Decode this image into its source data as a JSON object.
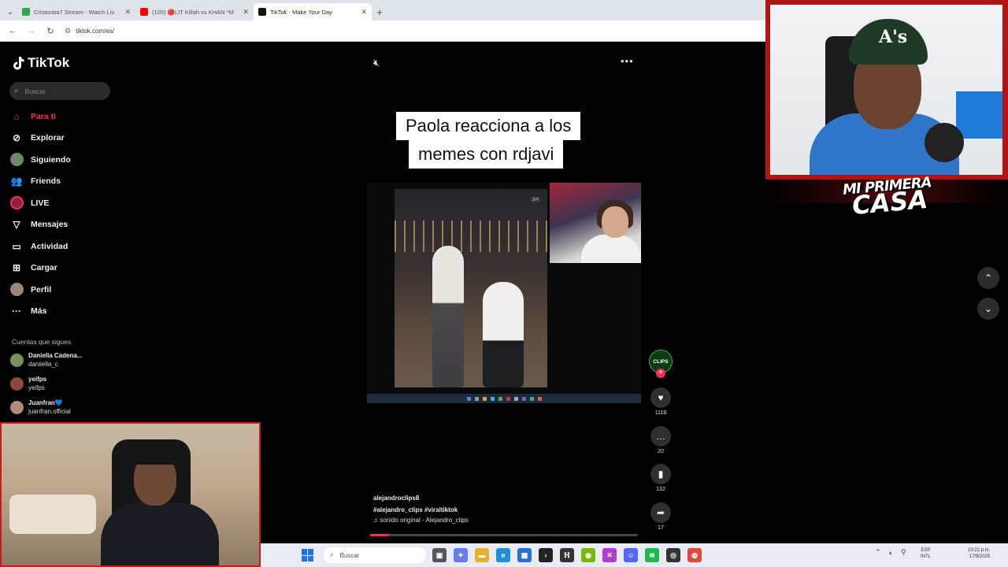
{
  "browser": {
    "tabs": [
      {
        "title": "Cristorata7 Stream - Watch Liv",
        "favicon_color": "#2ea44f"
      },
      {
        "title": "(105) 🔴LIT Killah vs KHAN *M",
        "favicon_color": "#ff0000"
      },
      {
        "title": "TikTok - Make Your Day",
        "favicon_color": "#111111"
      }
    ],
    "url": "tiktok.com/es/"
  },
  "tiktok": {
    "logo": "TikTok",
    "search_placeholder": "Buscar",
    "nav": [
      {
        "label": "Para ti",
        "icon": "home-icon",
        "active": true
      },
      {
        "label": "Explorar",
        "icon": "compass-icon"
      },
      {
        "label": "Siguiendo",
        "icon": "following-avatar-icon"
      },
      {
        "label": "Friends",
        "icon": "friends-icon"
      },
      {
        "label": "LIVE",
        "icon": "live-icon"
      },
      {
        "label": "Mensajes",
        "icon": "send-icon"
      },
      {
        "label": "Actividad",
        "icon": "inbox-icon"
      },
      {
        "label": "Cargar",
        "icon": "upload-icon"
      },
      {
        "label": "Perfil",
        "icon": "profile-avatar-icon"
      },
      {
        "label": "Más",
        "icon": "more-icon"
      }
    ],
    "following_title": "Cuentas que sigues",
    "following": [
      {
        "name": "Daniella Cadena...",
        "handle": "daniiella_c",
        "color": "#7a8f5a"
      },
      {
        "name": "yeifps",
        "handle": "yeifps",
        "color": "#8a4a3a"
      },
      {
        "name": "Juanfran💙",
        "handle": "juanfran.official",
        "color": "#b08a7a"
      }
    ],
    "video": {
      "caption_line1": "Paola reacciona a los",
      "caption_line2": "memes con rdjavi",
      "photo_counter": "3/4",
      "username": "alejandroclips8",
      "hashtags": "#alejandro_clips  #viraltiktok",
      "sound": "♫ sonido original - Alejandro_clips",
      "progress": 0.07,
      "creator_badge": "CLIPS"
    },
    "actions": {
      "likes": "1118",
      "comments": "20",
      "saves": "132",
      "shares": "17"
    }
  },
  "overlay": {
    "brand_line1": "MI PRIMERA",
    "brand_line2": "CASA"
  },
  "taskbar": {
    "search_label": "Buscar",
    "lang_line1": "ESP",
    "lang_line2": "INTL",
    "time": "10:22 p.m.",
    "date": "17/9/2025"
  }
}
